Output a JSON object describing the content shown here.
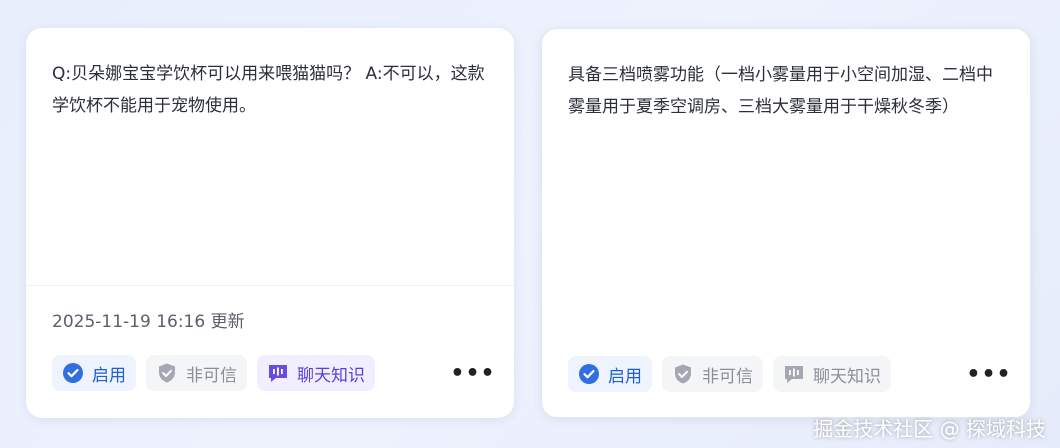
{
  "cards": [
    {
      "content": "Q:贝朵娜宝宝学饮杯可以用来喂猫猫吗？ A:不可以，这款学饮杯不能用于宠物使用。",
      "timestamp": "2025-11-19 16:16 更新",
      "actions": {
        "enable_label": "启用",
        "untrusted_label": "非可信",
        "chat_label": "聊天知识"
      },
      "more": "•••"
    },
    {
      "content": "具备三档喷雾功能（一档小雾量用于小空间加湿、二档中雾量用于夏季空调房、三档大雾量用于干燥秋冬季）",
      "actions": {
        "enable_label": "启用",
        "untrusted_label": "非可信",
        "chat_label": "聊天知识"
      },
      "more": "•••"
    }
  ],
  "watermark": "掘金技术社区 @ 探域科技",
  "colors": {
    "enable": "#1f5fd0",
    "untrusted": "#8a8f99",
    "chat_active": "#5b3fd6"
  }
}
